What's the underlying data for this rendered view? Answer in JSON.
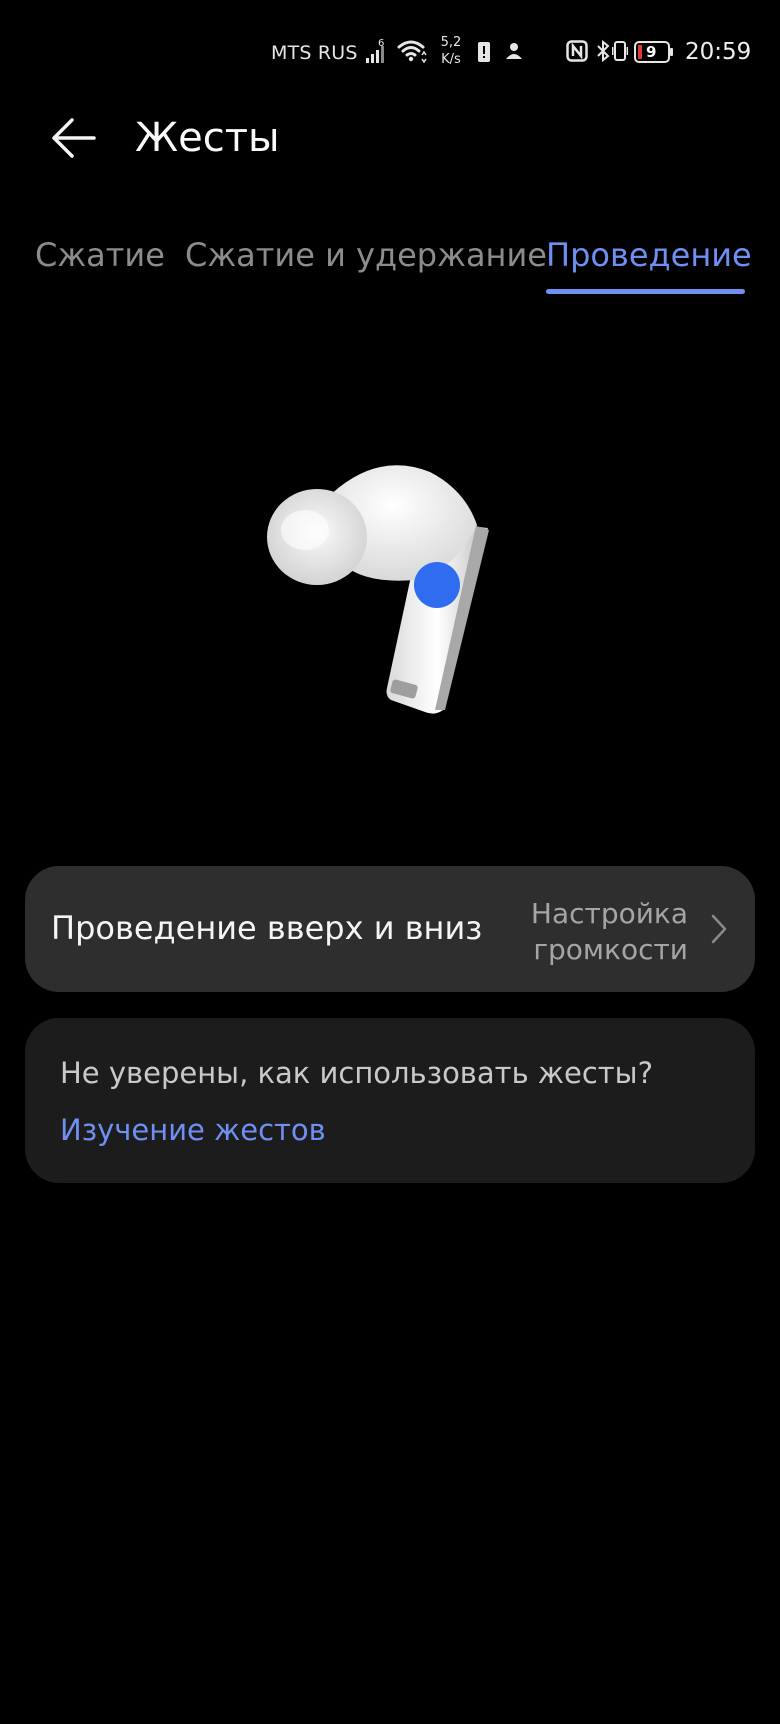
{
  "status_bar": {
    "carrier": "MTS RUS",
    "network_type": "6",
    "speed_value": "5,2",
    "speed_unit": "K/s",
    "battery_level": "9",
    "time": "20:59"
  },
  "header": {
    "title": "Жесты"
  },
  "tabs": [
    {
      "label": "Сжатие"
    },
    {
      "label": "Сжатие и удержание"
    },
    {
      "label": "Проведение",
      "active": true
    }
  ],
  "setting": {
    "label": "Проведение вверх и вниз",
    "value_line1": "Настройка",
    "value_line2": "громкости"
  },
  "help": {
    "question": "Не уверены, как использовать жесты?",
    "link": "Изучение жестов"
  },
  "colors": {
    "accent": "#6f8ff2",
    "background": "#000000",
    "card": "#2e2e2e",
    "touch_point": "#2f6cf0"
  }
}
